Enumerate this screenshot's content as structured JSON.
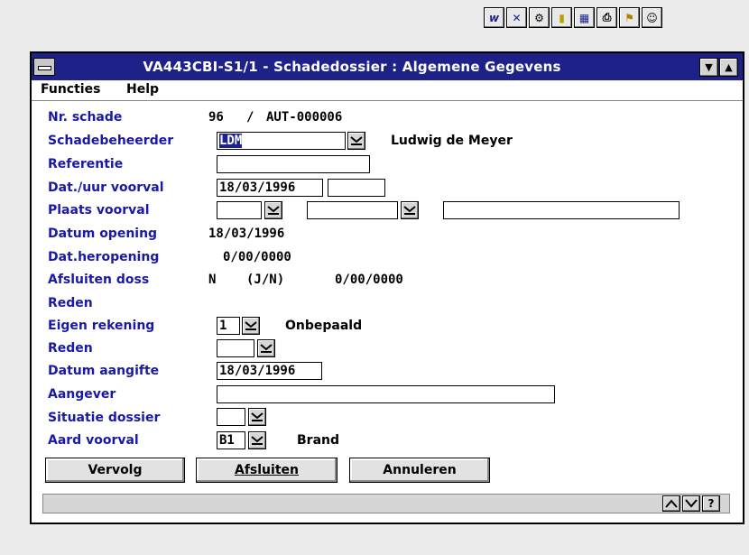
{
  "window": {
    "title": "VA443CBI-S1/1 - Schadedossier : Algemene Gegevens",
    "scroll_down": "▼",
    "scroll_up": "▲"
  },
  "menu": {
    "functies": "Functies",
    "help": "Help"
  },
  "toolbar": {
    "icons": [
      "w-icon",
      "x-icon",
      "gear-icon",
      "document-icon",
      "calculator-icon",
      "printer-icon",
      "search-icon",
      "people-icon"
    ]
  },
  "form": {
    "labels": {
      "nr_schade": "Nr. schade",
      "schadebeheerder": "Schadebeheerder",
      "referentie": "Referentie",
      "dat_uur_voorval": "Dat./uur voorval",
      "plaats_voorval": "Plaats voorval",
      "datum_opening": "Datum opening",
      "dat_heropening": "Dat.heropening",
      "afsluiten_doss": "Afsluiten doss",
      "reden1": "Reden",
      "eigen_rekening": "Eigen rekening",
      "reden2": "Reden",
      "datum_aangifte": "Datum aangifte",
      "aangever": "Aangever",
      "situatie_dossier": "Situatie dossier",
      "aard_voorval": "Aard voorval"
    },
    "nr_schade_num": "96",
    "nr_schade_sep": "/",
    "nr_schade_code": "AUT-000006",
    "schadebeheerder_code": "LDM",
    "schadebeheerder_name": "Ludwig de Meyer",
    "referentie": "",
    "dat_voorval": "18/03/1996",
    "uur_voorval": "",
    "datum_opening": "18/03/1996",
    "dat_heropening": "0/00/0000",
    "afsluiten_flag": "N",
    "afsluiten_hint": "(J/N)",
    "afsluiten_date": "0/00/0000",
    "eigen_rekening_code": "1",
    "eigen_rekening_text": "Onbepaald",
    "datum_aangifte": "18/03/1996",
    "aangever": "",
    "aard_voorval_code": "B1",
    "aard_voorval_text": "Brand"
  },
  "buttons": {
    "vervolg": "Vervolg",
    "afsluiten": "Afsluiten",
    "annuleren": "Annuleren"
  },
  "statusbar": {
    "up": "^",
    "down": "v",
    "help": "?"
  }
}
